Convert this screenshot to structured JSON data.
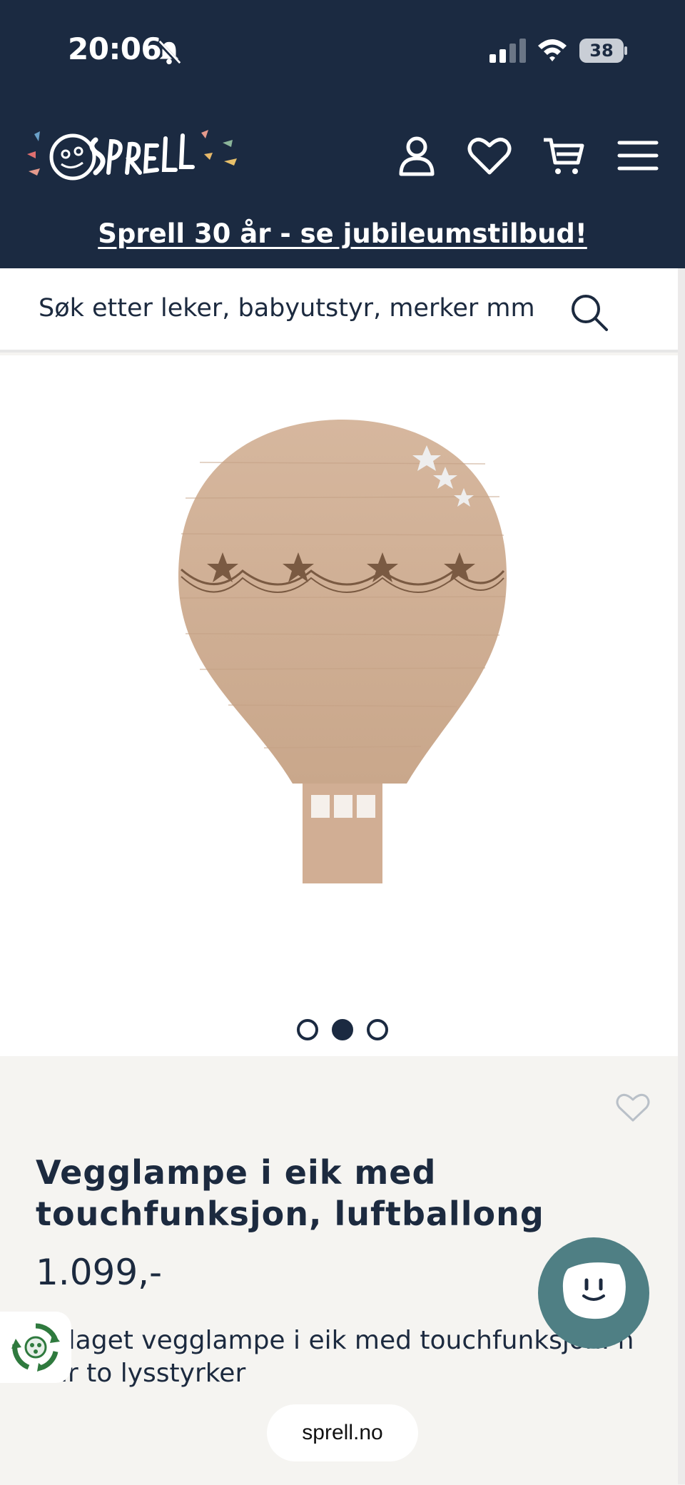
{
  "status_bar": {
    "time": "20:06",
    "icons": [
      "bell-muted-icon",
      "signal-icon",
      "wifi-icon",
      "battery-icon"
    ],
    "battery_level": "38"
  },
  "header": {
    "brand_colors": {
      "navy": "#1b2a41",
      "teal": "#4f7f84"
    },
    "icons": [
      "user-icon",
      "heart-icon",
      "cart-icon",
      "menu-icon"
    ],
    "promo_link": "Sprell 30 år - se jubileumstilbud!"
  },
  "search": {
    "placeholder": "Søk etter leker, babyutstyr, merker mm"
  },
  "gallery": {
    "image_count": 3,
    "active_index": 1
  },
  "product": {
    "title": "Vegglampe i eik med touchfunksjon, luftballong",
    "price": "1.099,-",
    "description": "ndlaget vegglampe i eik med touchfunksjon. n har to lysstyrker"
  },
  "browser": {
    "url": "sprell.no"
  }
}
